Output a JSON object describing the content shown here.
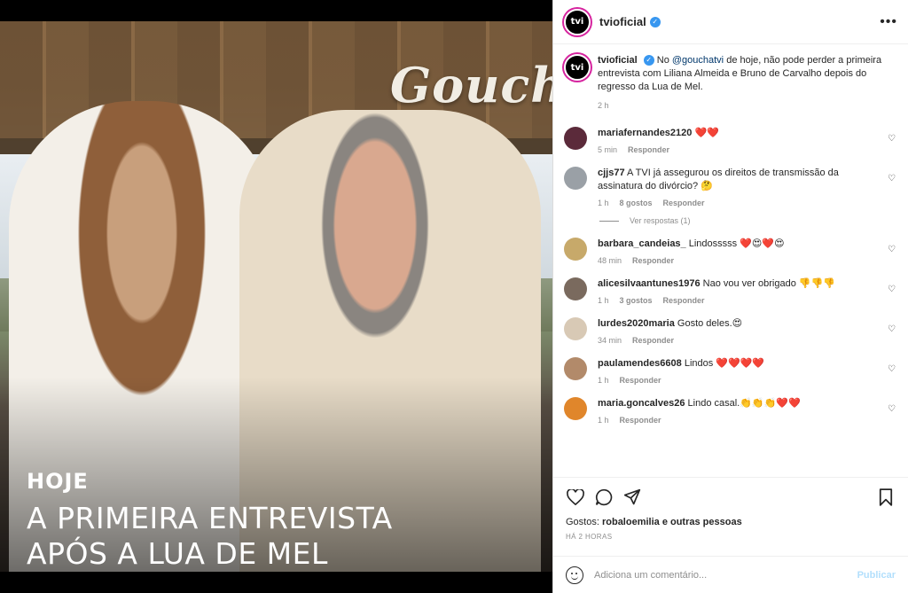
{
  "media": {
    "brand": "Goucha",
    "kicker": "HOJE",
    "line1": "A PRIMEIRA ENTREVISTA",
    "line2": "APÓS A LUA DE MEL"
  },
  "header": {
    "avatar_text": "tvi",
    "username": "tvioficial",
    "verified_icon": "verified-badge",
    "more_icon": "more-options-icon"
  },
  "caption": {
    "username": "tvioficial",
    "prefix": "No ",
    "mention": "@gouchatvi",
    "text": " de hoje, não pode perder a primeira entrevista com Liliana Almeida e Bruno de Carvalho depois do regresso da Lua de Mel.",
    "time": "2 h"
  },
  "comments": [
    {
      "user": "mariafernandes2120",
      "text": "❤️❤️",
      "time": "5 min",
      "likes": "",
      "reply": "Responder",
      "color": "#5b2a3a"
    },
    {
      "user": "cjjs77",
      "text": "A TVI já assegurou os direitos de transmissão da assinatura do divórcio? 🤔",
      "time": "1 h",
      "likes": "8 gostos",
      "reply": "Responder",
      "color": "#9aa0a6"
    },
    {
      "user": "barbara_candeias_",
      "text": "Lindosssss ❤️😍❤️😍",
      "time": "48 min",
      "likes": "",
      "reply": "Responder",
      "color": "#c7a96a"
    },
    {
      "user": "alicesilvaantunes1976",
      "text": "Nao vou ver obrigado 👎👎👎",
      "time": "1 h",
      "likes": "3 gostos",
      "reply": "Responder",
      "color": "#7a6a5e"
    },
    {
      "user": "lurdes2020maria",
      "text": "Gosto deles.😍",
      "time": "34 min",
      "likes": "",
      "reply": "Responder",
      "color": "#d8c9b5"
    },
    {
      "user": "paulamendes6608",
      "text": "Lindos ❤️❤️❤️❤️",
      "time": "1 h",
      "likes": "",
      "reply": "Responder",
      "color": "#b28a6a"
    },
    {
      "user": "maria.goncalves26",
      "text": "Lindo casal.👏👏👏❤️❤️",
      "time": "1 h",
      "likes": "",
      "reply": "Responder",
      "color": "#e0862b"
    }
  ],
  "view_replies": "Ver respostas (1)",
  "actions": {
    "likes_prefix": "Gostos: ",
    "likes_user": "robaloemilia",
    "likes_suffix": " e outras pessoas",
    "time": "HÁ 2 HORAS"
  },
  "add_comment": {
    "placeholder": "Adiciona um comentário...",
    "post": "Publicar"
  }
}
